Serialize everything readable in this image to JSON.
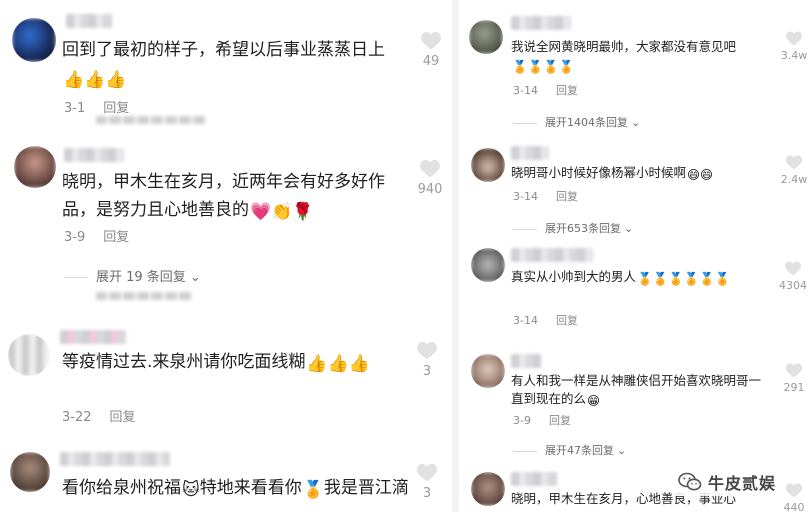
{
  "colors": {
    "like_gray": "#9a9a9a",
    "meta_gray": "#8a8a8a",
    "heart_pink": "#e84a8a"
  },
  "left": {
    "comments": [
      {
        "text": "回到了最初的样子，希望以后事业蒸蒸日上",
        "emojis": "👍👍👍",
        "date": "3-1",
        "reply": "回复",
        "likes": "49"
      },
      {
        "text": "晓明，甲木生在亥月，近两年会有好多好作品，是努力且心地善良的",
        "emojis": "💗👏🌹",
        "date": "3-9",
        "reply": "回复",
        "likes": "940",
        "expand": "展开 19 条回复"
      },
      {
        "text": "等疫情过去.来泉州请你吃面线糊",
        "emojis": "👍👍👍",
        "date": "3-22",
        "reply": "回复",
        "likes": "3"
      },
      {
        "text": "看你给泉州祝福",
        "text_mid": "特地来看看你",
        "text_end": "我是晋江滴",
        "emojis": "🐱🏅",
        "likes": "3"
      }
    ]
  },
  "right": {
    "comments": [
      {
        "text": "我说全网黄晓明最帅，大家都没有意见吧",
        "emojis": "🏅🏅🏅🏅",
        "date": "3-14",
        "reply": "回复",
        "likes": "3.4w",
        "expand": "展开1404条回复"
      },
      {
        "text": "晓明哥小时候好像杨幂小时候啊",
        "emojis": "😄😄",
        "date": "3-14",
        "reply": "回复",
        "likes": "2.4w",
        "expand": "展开653条回复"
      },
      {
        "text": "真实从小帅到大的男人",
        "emojis": "🏅🏅🏅🏅🏅🏅",
        "date": "3-14",
        "reply": "回复",
        "likes": "4304"
      },
      {
        "text": "有人和我一样是从神雕侠侣开始喜欢晓明哥一直到现在的么",
        "emojis": "😁",
        "date": "3-9",
        "reply": "回复",
        "likes": "291",
        "expand": "展开47条回复"
      },
      {
        "text": "晓明，甲木生在亥月，心地善良，事业心",
        "likes": "440"
      }
    ]
  },
  "watermark": {
    "text": "牛皮贰娱",
    "icon": "wechat-icon"
  }
}
